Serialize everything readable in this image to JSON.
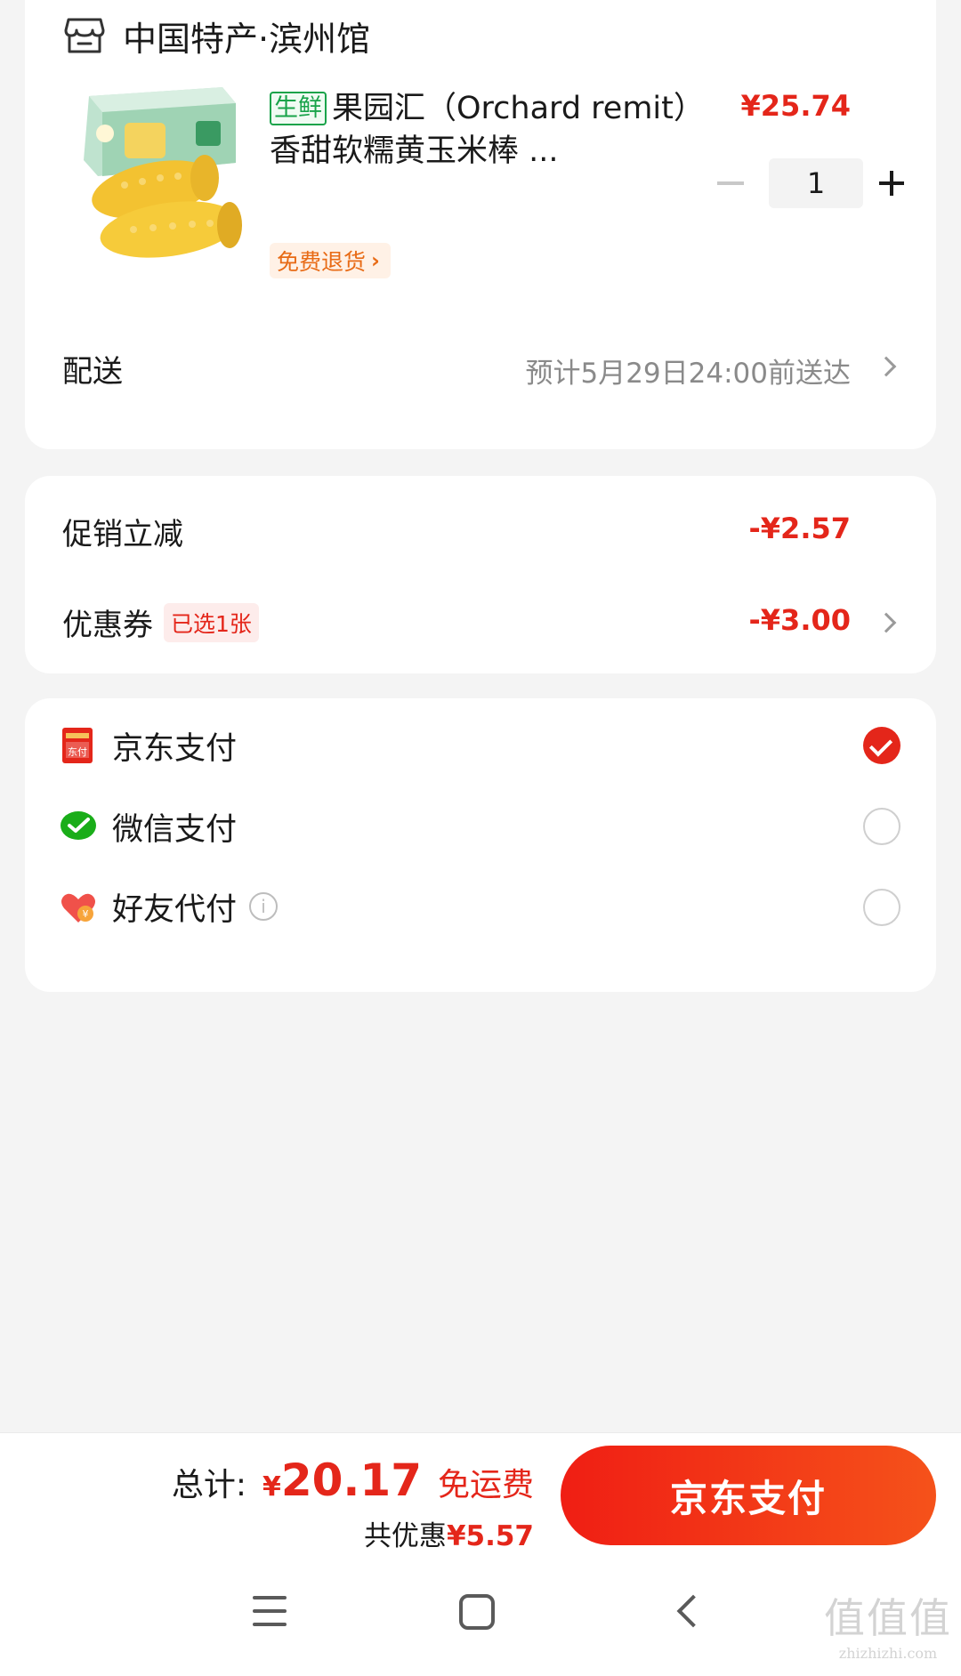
{
  "store": {
    "name": "中国特产·滨州馆",
    "icon": "store-icon"
  },
  "product": {
    "tag": "生鲜",
    "title": "果园汇（Orchard remit）香甜软糯黄玉米棒 ...",
    "price": "¥25.74",
    "quantity": "1",
    "return_badge": "免费退货",
    "image": "corn-box-image"
  },
  "delivery": {
    "label": "配送",
    "value": "预计5月29日24:00前送达"
  },
  "discounts": {
    "promo_label": "促销立减",
    "promo_value": "-¥2.57",
    "coupon_label": "优惠券",
    "coupon_chip": "已选1张",
    "coupon_value": "-¥3.00"
  },
  "payment": {
    "methods": [
      {
        "label": "京东支付",
        "icon": "jd-pay-icon",
        "selected": true
      },
      {
        "label": "微信支付",
        "icon": "wechat-pay-icon",
        "selected": false
      },
      {
        "label": "好友代付",
        "icon": "friend-pay-icon",
        "selected": false
      }
    ]
  },
  "footer": {
    "total_label": "总计:",
    "currency": "¥",
    "total_amount": "20.17",
    "free_shipping": "免运费",
    "saving_label": "共优惠",
    "saving_amount": "¥5.57",
    "pay_button": "京东支付"
  },
  "watermark": {
    "mark": "值值值",
    "url": "zhizhizhi.com"
  },
  "colors": {
    "accent": "#e4261a",
    "fresh": "#19a34a",
    "return": "#e86b16"
  }
}
